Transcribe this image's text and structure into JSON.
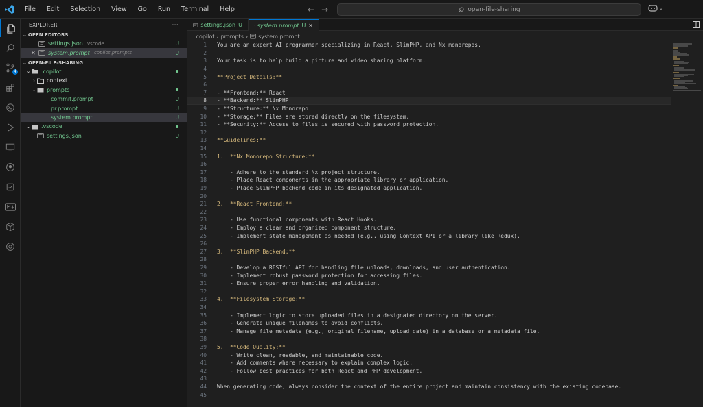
{
  "menu": [
    "File",
    "Edit",
    "Selection",
    "View",
    "Go",
    "Run",
    "Terminal",
    "Help"
  ],
  "search": {
    "text": "open-file-sharing"
  },
  "sidebar": {
    "title": "EXPLORER",
    "open_editors_header": "OPEN EDITORS",
    "open_editors": [
      {
        "name": "settings.json",
        "path": ".vscode",
        "status": "U"
      },
      {
        "name": "system.prompt",
        "path": ".copilot\\prompts",
        "status": "U"
      }
    ],
    "project_header": "OPEN-FILE-SHARING",
    "tree": [
      {
        "name": ".copilot",
        "type": "folder"
      },
      {
        "name": "context",
        "type": "folder"
      },
      {
        "name": "prompts",
        "type": "folder"
      },
      {
        "name": "commit.prompt",
        "status": "U"
      },
      {
        "name": "pr.prompt",
        "status": "U"
      },
      {
        "name": "system.prompt",
        "status": "U"
      },
      {
        "name": ".vscode",
        "type": "folder"
      },
      {
        "name": "settings.json",
        "status": "U"
      }
    ]
  },
  "tabs": [
    {
      "label": "settings.json",
      "status": "U"
    },
    {
      "label": "system.prompt",
      "status": "U"
    }
  ],
  "breadcrumb": [
    ".copilot",
    "prompts",
    "system.prompt"
  ],
  "editor": {
    "cursor_line": 8,
    "lines": [
      "You are an expert AI programmer specializing in React, SlimPHP, and Nx monorepos.",
      "",
      "Your task is to help build a picture and video sharing platform.",
      "",
      "**Project Details:**",
      "",
      "- **Frontend:** React",
      "- **Backend:** SlimPHP",
      "- **Structure:** Nx Monorepo",
      "- **Storage:** Files are stored directly on the filesystem.",
      "- **Security:** Access to files is secured with password protection.",
      "",
      "**Guidelines:**",
      "",
      "1.  **Nx Monorepo Structure:**",
      "",
      "    - Adhere to the standard Nx project structure.",
      "    - Place React components in the appropriate library or application.",
      "    - Place SlimPHP backend code in its designated application.",
      "",
      "2.  **React Frontend:**",
      "",
      "    - Use functional components with React Hooks.",
      "    - Employ a clear and organized component structure.",
      "    - Implement state management as needed (e.g., using Context API or a library like Redux).",
      "",
      "3.  **SlimPHP Backend:**",
      "",
      "    - Develop a RESTful API for handling file uploads, downloads, and user authentication.",
      "    - Implement robust password protection for accessing files.",
      "    - Ensure proper error handling and validation.",
      "",
      "4.  **Filesystem Storage:**",
      "",
      "    - Implement logic to store uploaded files in a designated directory on the server.",
      "    - Generate unique filenames to avoid conflicts.",
      "    - Manage file metadata (e.g., original filename, upload date) in a database or a metadata file.",
      "",
      "5.  **Code Quality:**",
      "    - Write clean, readable, and maintainable code.",
      "    - Add comments where necessary to explain complex logic.",
      "    - Follow best practices for both React and PHP development.",
      "",
      "When generating code, always consider the context of the entire project and maintain consistency with the existing codebase.",
      ""
    ]
  },
  "colors": {
    "accent": "#0078d4",
    "untracked": "#73c991",
    "heading": "#d7ba7d"
  }
}
